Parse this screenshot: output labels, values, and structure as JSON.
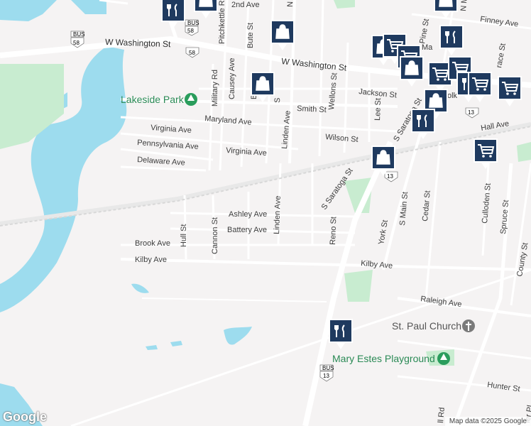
{
  "streets": {
    "second_ave": "2nd Ave",
    "w_washington_1": "W Washington St",
    "w_washington_2": "W Washington St",
    "pitchkettle": "Pitchkettle R",
    "bute": "Bute St",
    "causey": "Causey Ave",
    "military": "Military Rd",
    "maryland": "Maryland Ave",
    "virginia_1": "Virginia Ave",
    "virginia_2": "Virginia Ave",
    "pennsylvania": "Pennsylvania Ave",
    "delaware": "Delaware Ave",
    "linden_1": "Linden Ave",
    "linden_2": "Linden Ave",
    "smith": "Smith St",
    "wilson": "Wilson St",
    "wellons": "Wellons St",
    "jackson": "Jackson St",
    "lee": "Lee St",
    "pine": "Pine St",
    "finney": "Finney Ave",
    "hall": "Hall Ave",
    "s_saratoga_1": "S Saratoga St",
    "s_saratoga_2": "S Saratoga St",
    "ashley": "Ashley Ave",
    "battery": "Battery Ave",
    "hull": "Hull St",
    "cannon": "Cannon St",
    "brook": "Brook Ave",
    "kilby_1": "Kilby Ave",
    "kilby_2": "Kilby Ave",
    "reno": "Reno St",
    "york": "York St",
    "s_main": "S Main St",
    "cedar": "Cedar St",
    "culloden": "Culloden St",
    "spruce": "Spruce St",
    "county": "County St",
    "raleigh": "Raleigh Ave",
    "hunter": "Hunter St",
    "n_partial": "N",
    "s_partial_1": "S",
    "b_partial": "B",
    "n_m_partial": "N M",
    "race_partial": "race St",
    "ll_rd_partial": "ll Rd",
    "ier_partial": "ier Pl",
    "pol_partial": "olk",
    "ma_partial": "Ma"
  },
  "pois": {
    "lakeside_park": "Lakeside Park",
    "st_paul": "St. Paul Church",
    "mary_estes": "Mary Estes Playground"
  },
  "shields": {
    "bus58_top": "BUS",
    "route58_top": "58",
    "bus58_left": "BUS",
    "route58_left": "58",
    "route58_mid": "58",
    "route13_mid": "13",
    "route13_right": "13",
    "bus13_bottom": "BUS",
    "route13_bottom": "13"
  },
  "markers": {
    "icons": [
      "restaurant-icon",
      "shopping-bag-icon",
      "shopping-cart-icon"
    ]
  },
  "attribution": {
    "logo": "Google",
    "text": "Map data ©2025 Google"
  },
  "colors": {
    "water": "#9ddcee",
    "park": "#c8ecd0",
    "land": "#f5f3f3",
    "road": "#ffffff",
    "marker": "#1f3a5f"
  }
}
